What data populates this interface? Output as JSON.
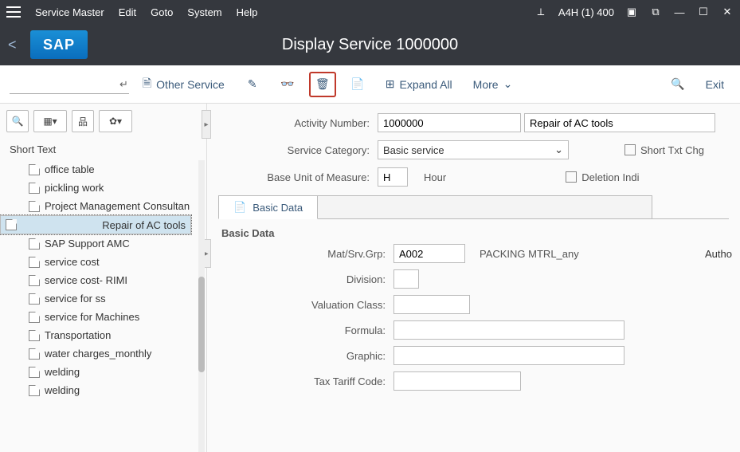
{
  "menu": {
    "service_master": "Service Master",
    "edit": "Edit",
    "goto": "Goto",
    "system": "System",
    "help": "Help",
    "session": "A4H (1) 400"
  },
  "title": "Display Service 1000000",
  "toolbar": {
    "other_service": "Other Service",
    "expand_all": "Expand All",
    "more": "More",
    "exit": "Exit"
  },
  "tree": {
    "header": "Short Text",
    "items": [
      "office table",
      "pickling work",
      "Project Management Consultan",
      "Repair of AC tools",
      "SAP Support AMC",
      "service cost",
      "service cost- RIMI",
      "service for ss",
      "service for Machines",
      "Transportation",
      "water charges_monthly",
      "welding",
      "welding"
    ]
  },
  "form": {
    "activity_label": "Activity Number:",
    "activity_value": "1000000",
    "activity_desc": "Repair of AC tools",
    "category_label": "Service Category:",
    "category_value": "Basic service",
    "short_text_chg": "Short Txt Chg",
    "uom_label": "Base Unit of Measure:",
    "uom_value": "H",
    "uom_text": "Hour",
    "deletion": "Deletion Indi",
    "tab_basic": "Basic Data",
    "section_basic": "Basic Data",
    "mat_group_label": "Mat/Srv.Grp:",
    "mat_group_value": "A002",
    "mat_group_desc": "PACKING MTRL_any",
    "auth_label": "Autho",
    "division_label": "Division:",
    "valuation_label": "Valuation Class:",
    "formula_label": "Formula:",
    "graphic_label": "Graphic:",
    "tax_label": "Tax Tariff Code:"
  }
}
